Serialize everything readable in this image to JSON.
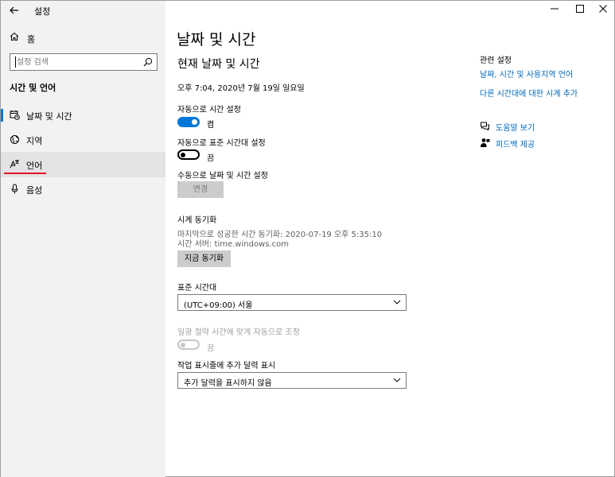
{
  "titlebar": {
    "back_icon": "back-arrow-icon",
    "title": "설정",
    "minimize": "—",
    "maximize": "□",
    "close": "✕"
  },
  "sidebar": {
    "home_label": "홈",
    "search_placeholder": "설정 검색",
    "section_title": "시간 및 언어",
    "items": [
      {
        "label": "날짜 및 시간",
        "icon": "calendar-clock-icon"
      },
      {
        "label": "지역",
        "icon": "globe-icon"
      },
      {
        "label": "언어",
        "icon": "language-icon"
      },
      {
        "label": "음성",
        "icon": "microphone-icon"
      }
    ]
  },
  "main": {
    "page_title": "날짜 및 시간",
    "section_heading": "현재 날짜 및 시간",
    "current_datetime": "오후 7:04, 2020년 7월 19일 일요일",
    "auto_time": {
      "label": "자동으로 시간 설정",
      "state": "켬"
    },
    "auto_timezone": {
      "label": "자동으로 표준 시간대 설정",
      "state": "끔"
    },
    "manual": {
      "label": "수동으로 날짜 및 시간 설정",
      "button": "변경"
    },
    "sync": {
      "title": "시계 동기화",
      "last_sync": "마지막으로 성공한 시간 동기화: 2020-07-19 오후 5:35:10",
      "server": "시간 서버: time.windows.com",
      "button": "지금 동기화"
    },
    "timezone": {
      "label": "표준 시간대",
      "value": "(UTC+09:00) 서울"
    },
    "dst": {
      "label": "일광 절약 시간에 맞게 자동으로 조정",
      "state": "끔"
    },
    "taskbar_calendar": {
      "label": "작업 표시줄에 추가 달력 표시",
      "value": "추가 달력을 표시하지 않음"
    }
  },
  "related": {
    "title": "관련 설정",
    "links": [
      "날짜, 시간 및 사용지역 언어",
      "다른 시간대에 대한 시계 추가"
    ],
    "help": "도움말 보기",
    "feedback": "피드백 제공"
  },
  "colors": {
    "accent": "#0078d7",
    "link": "#0067b8",
    "sidebar_bg": "#f2f2f2",
    "active_bg": "#e3e3e3",
    "underline": "#e81123"
  }
}
